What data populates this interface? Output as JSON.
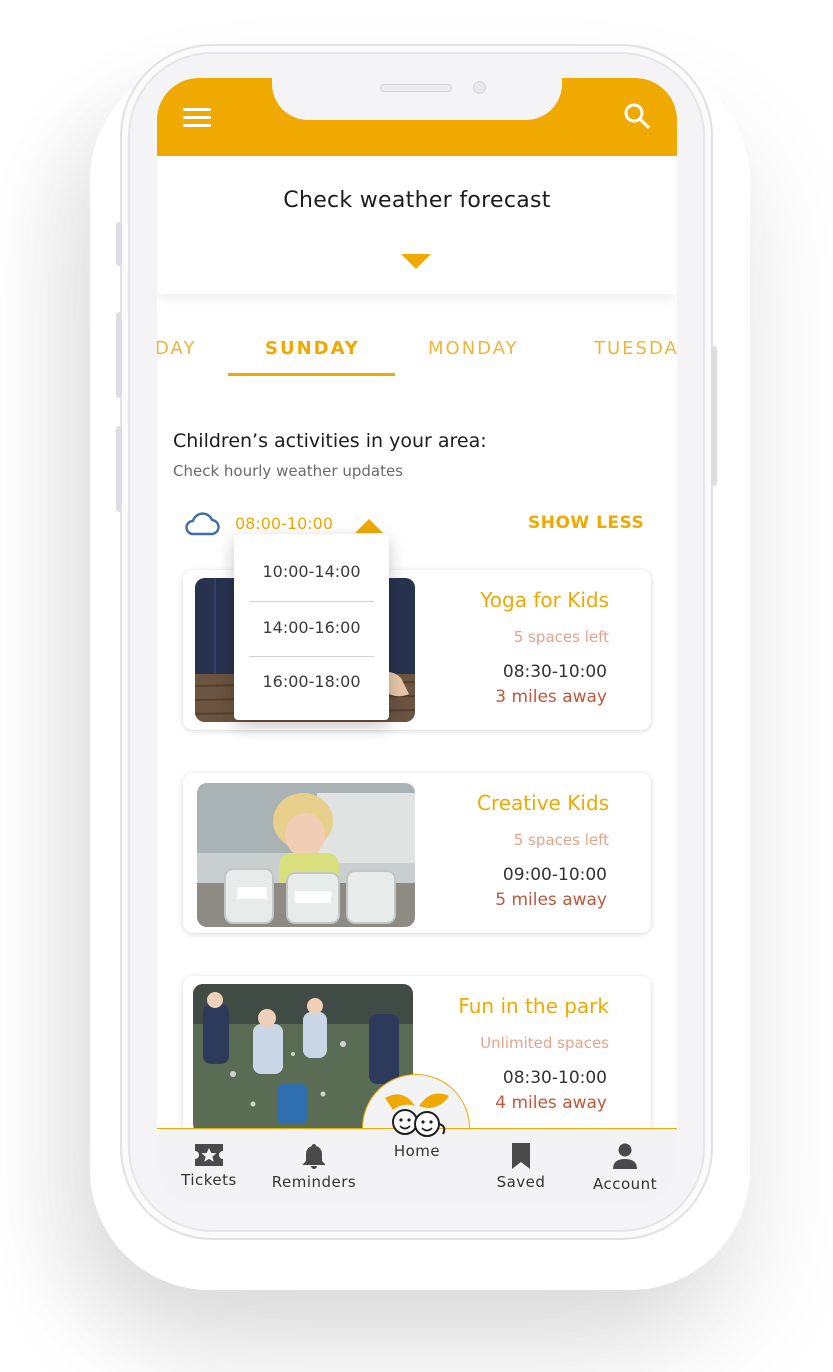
{
  "header": {
    "menu_icon": "hamburger-menu-icon",
    "search_icon": "search-icon",
    "accent_color": "#efa900"
  },
  "weather": {
    "title": "Check weather forecast"
  },
  "day_tabs": {
    "items": [
      "DAY",
      "SUNDAY",
      "MONDAY",
      "TUESDA"
    ],
    "active": "SUNDAY"
  },
  "section": {
    "title": "Children’s activities in your area:",
    "subtitle": "Check hourly weather updates"
  },
  "time_filter": {
    "selected": "08:00-10:00",
    "toggle_label": "SHOW LESS",
    "options": [
      "10:00-14:00",
      "14:00-16:00",
      "16:00-18:00"
    ]
  },
  "activities": [
    {
      "name": "Yoga for Kids",
      "spaces": "5 spaces left",
      "time": "08:30-10:00",
      "distance": "3 miles away"
    },
    {
      "name": "Creative Kids",
      "spaces": "5 spaces left",
      "time": "09:00-10:00",
      "distance": "5 miles away"
    },
    {
      "name": "Fun in the park",
      "spaces": "Unlimited spaces",
      "time": "08:30-10:00",
      "distance": "4 miles away"
    }
  ],
  "bottom_nav": {
    "tickets": "Tickets",
    "reminders": "Reminders",
    "home": "Home",
    "saved": "Saved",
    "account": "Account"
  }
}
